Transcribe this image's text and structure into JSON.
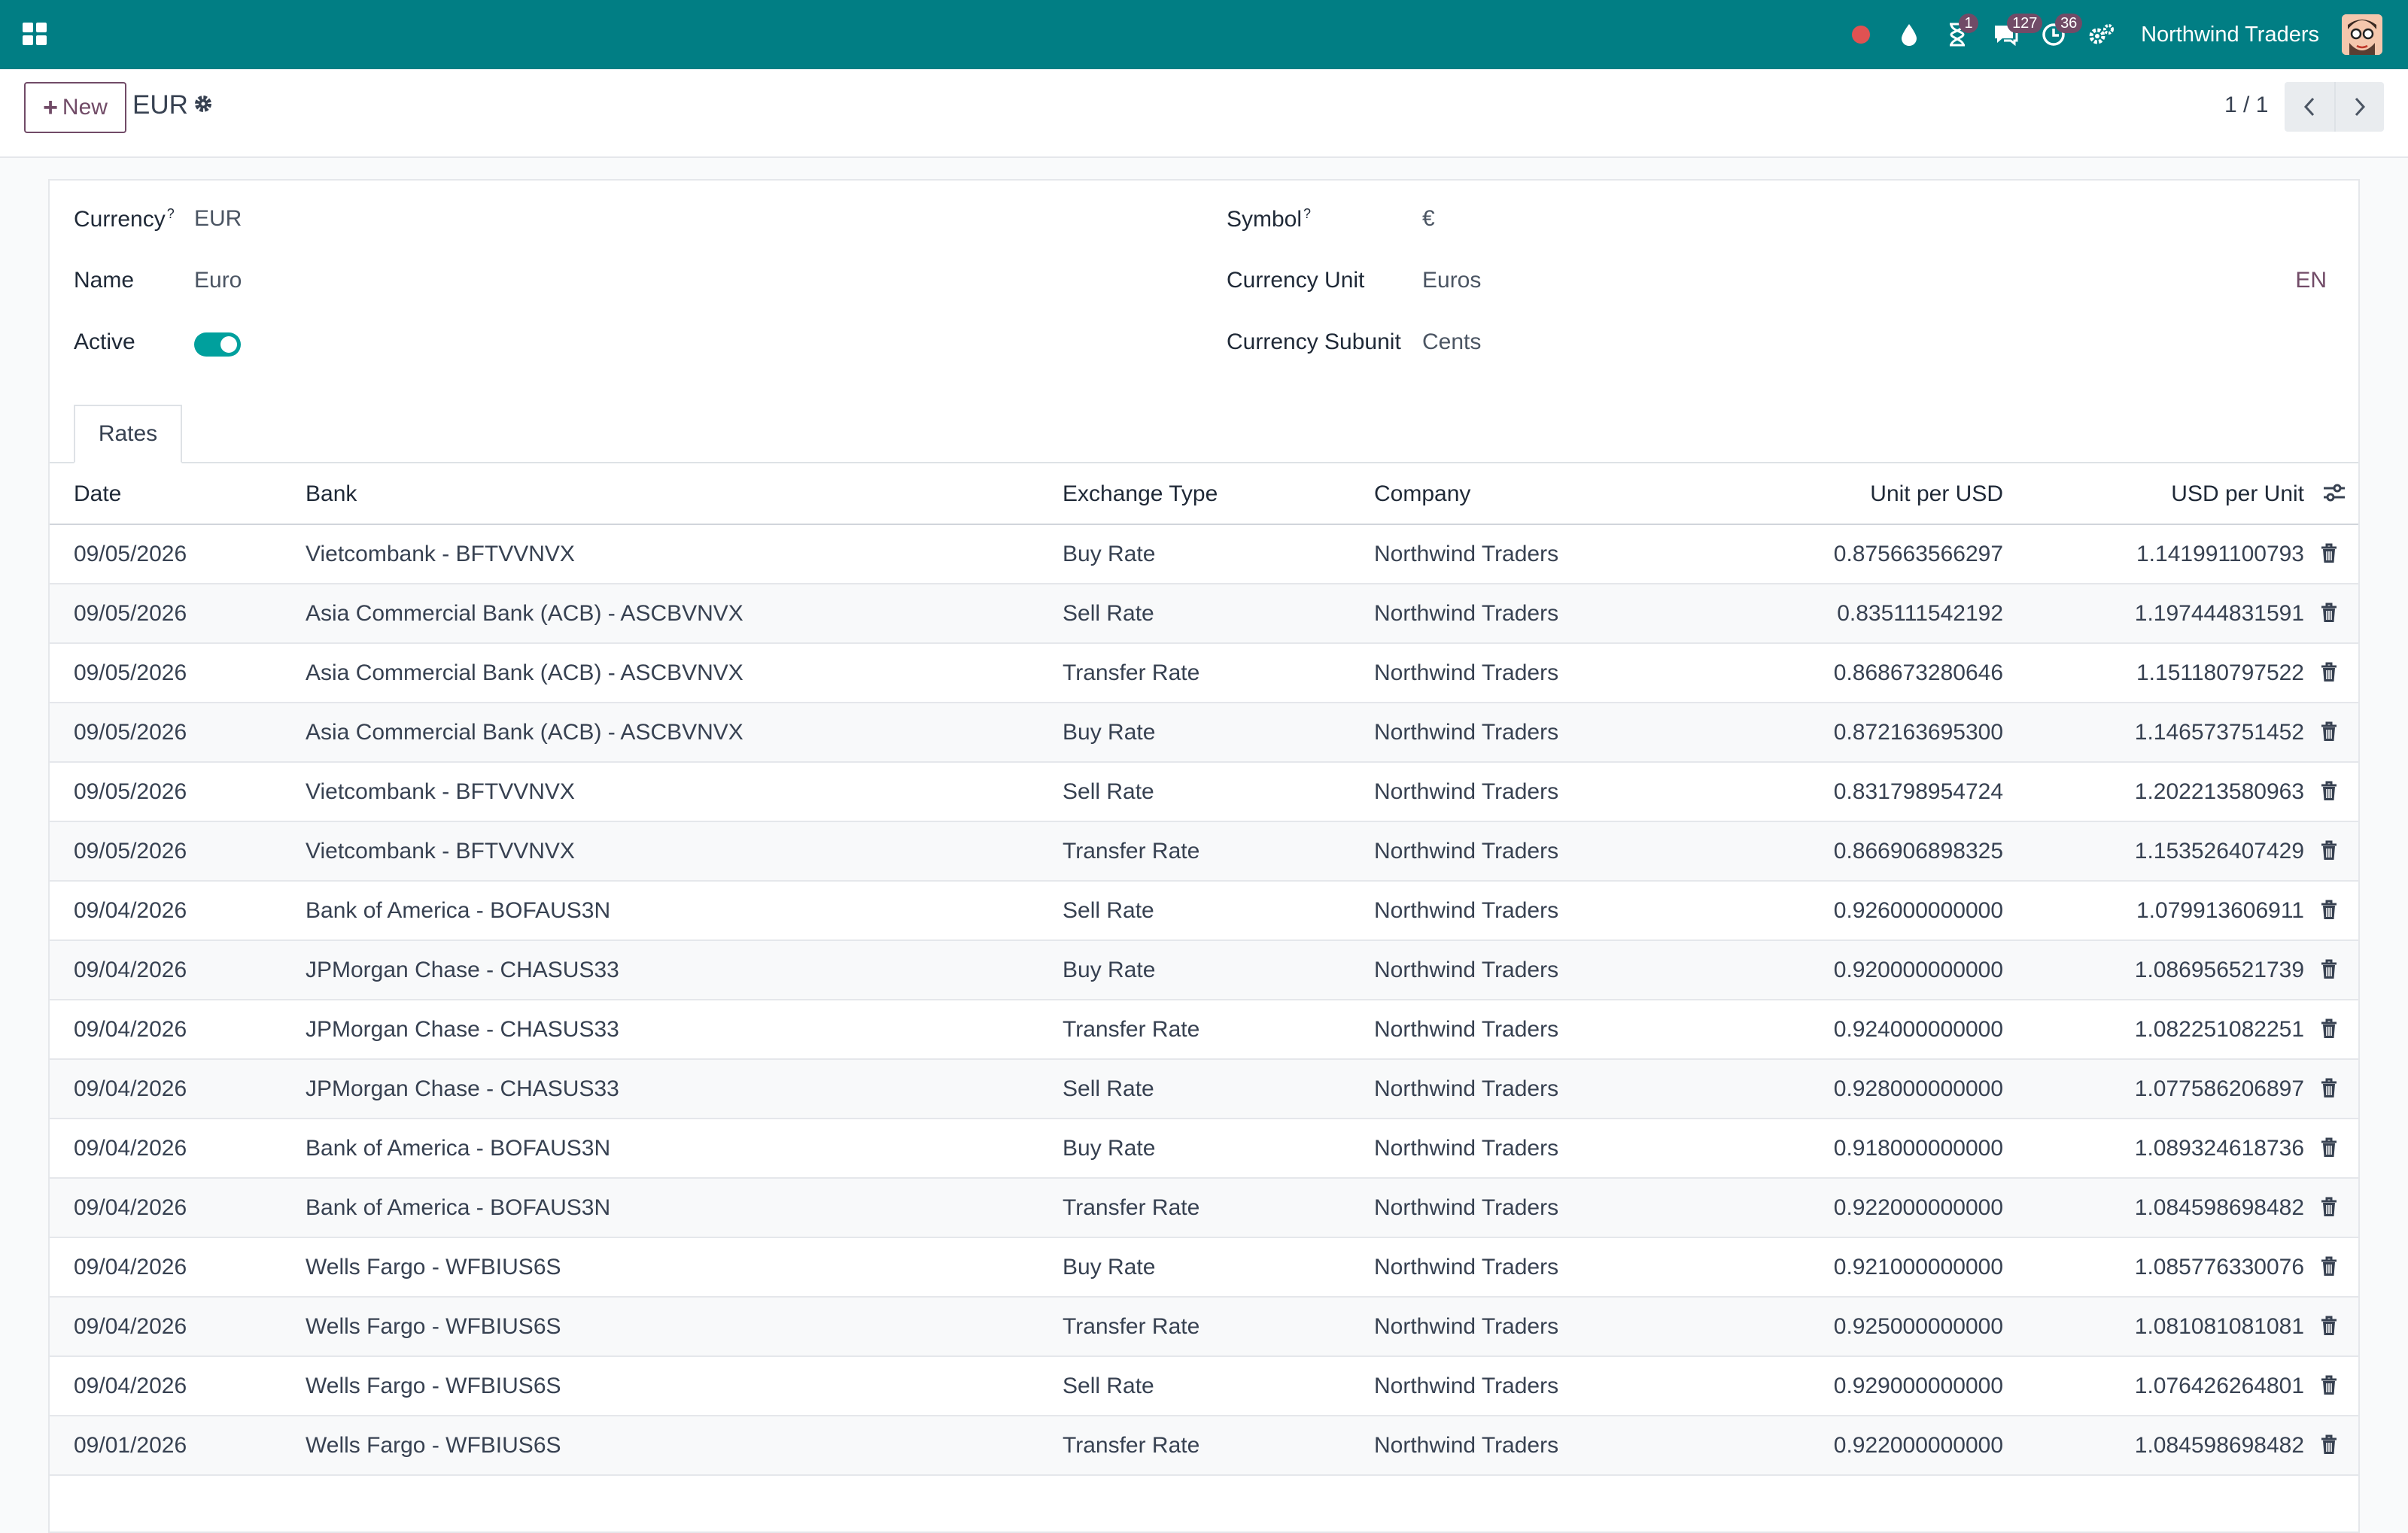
{
  "topbar": {
    "company_name": "Northwind Traders",
    "tray": [
      {
        "icon": "record-dot-icon",
        "badge": ""
      },
      {
        "icon": "drop-icon",
        "badge": ""
      },
      {
        "icon": "hourglass-icon",
        "badge": "1"
      },
      {
        "icon": "chat-icon",
        "badge": "127"
      },
      {
        "icon": "activity-clock-icon",
        "badge": "36"
      },
      {
        "icon": "settings-gears-icon",
        "badge": ""
      }
    ],
    "brand_color": "#017e84",
    "badge_color": "#714b67"
  },
  "control_panel": {
    "new_label": "New",
    "record_title": "EUR",
    "pager_value": "1 / 1"
  },
  "form": {
    "currency_label": "Currency",
    "currency_value": "EUR",
    "name_label": "Name",
    "name_value": "Euro",
    "active_label": "Active",
    "active_value": true,
    "symbol_label": "Symbol",
    "symbol_value": "€",
    "currency_unit_label": "Currency Unit",
    "currency_unit_value": "Euros",
    "currency_subunit_label": "Currency Subunit",
    "currency_subunit_value": "Cents",
    "lang_label": "EN",
    "help_mark": "?"
  },
  "tabs": [
    {
      "label": "Rates"
    }
  ],
  "rates_table": {
    "columns": [
      "Date",
      "Bank",
      "Exchange Type",
      "Company",
      "Unit per USD",
      "USD per Unit"
    ],
    "rows": [
      [
        "09/05/2026",
        "Vietcombank - BFTVVNVX",
        "Buy Rate",
        "Northwind Traders",
        "0.875663566297",
        "1.141991100793"
      ],
      [
        "09/05/2026",
        "Asia Commercial Bank (ACB) - ASCBVNVX",
        "Sell Rate",
        "Northwind Traders",
        "0.835111542192",
        "1.197444831591"
      ],
      [
        "09/05/2026",
        "Asia Commercial Bank (ACB) - ASCBVNVX",
        "Transfer Rate",
        "Northwind Traders",
        "0.868673280646",
        "1.151180797522"
      ],
      [
        "09/05/2026",
        "Asia Commercial Bank (ACB) - ASCBVNVX",
        "Buy Rate",
        "Northwind Traders",
        "0.872163695300",
        "1.146573751452"
      ],
      [
        "09/05/2026",
        "Vietcombank - BFTVVNVX",
        "Sell Rate",
        "Northwind Traders",
        "0.831798954724",
        "1.202213580963"
      ],
      [
        "09/05/2026",
        "Vietcombank - BFTVVNVX",
        "Transfer Rate",
        "Northwind Traders",
        "0.866906898325",
        "1.153526407429"
      ],
      [
        "09/04/2026",
        "Bank of America - BOFAUS3N",
        "Sell Rate",
        "Northwind Traders",
        "0.926000000000",
        "1.079913606911"
      ],
      [
        "09/04/2026",
        "JPMorgan Chase - CHASUS33",
        "Buy Rate",
        "Northwind Traders",
        "0.920000000000",
        "1.086956521739"
      ],
      [
        "09/04/2026",
        "JPMorgan Chase - CHASUS33",
        "Transfer Rate",
        "Northwind Traders",
        "0.924000000000",
        "1.082251082251"
      ],
      [
        "09/04/2026",
        "JPMorgan Chase - CHASUS33",
        "Sell Rate",
        "Northwind Traders",
        "0.928000000000",
        "1.077586206897"
      ],
      [
        "09/04/2026",
        "Bank of America - BOFAUS3N",
        "Buy Rate",
        "Northwind Traders",
        "0.918000000000",
        "1.089324618736"
      ],
      [
        "09/04/2026",
        "Bank of America - BOFAUS3N",
        "Transfer Rate",
        "Northwind Traders",
        "0.922000000000",
        "1.084598698482"
      ],
      [
        "09/04/2026",
        "Wells Fargo - WFBIUS6S",
        "Buy Rate",
        "Northwind Traders",
        "0.921000000000",
        "1.085776330076"
      ],
      [
        "09/04/2026",
        "Wells Fargo - WFBIUS6S",
        "Transfer Rate",
        "Northwind Traders",
        "0.925000000000",
        "1.081081081081"
      ],
      [
        "09/04/2026",
        "Wells Fargo - WFBIUS6S",
        "Sell Rate",
        "Northwind Traders",
        "0.929000000000",
        "1.076426264801"
      ],
      [
        "09/01/2026",
        "Wells Fargo - WFBIUS6S",
        "Transfer Rate",
        "Northwind Traders",
        "0.922000000000",
        "1.084598698482"
      ]
    ]
  }
}
